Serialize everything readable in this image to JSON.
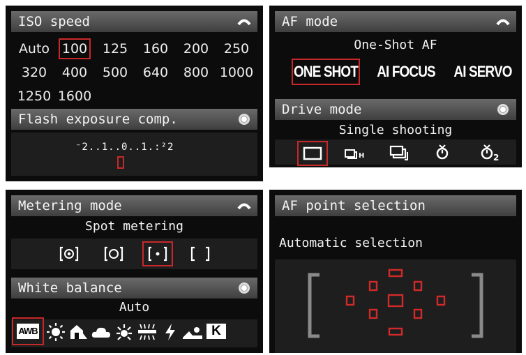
{
  "iso": {
    "title": "ISO speed",
    "header_icon": "eyebrow-arc-icon",
    "values": [
      "Auto",
      "100",
      "125",
      "160",
      "200",
      "250",
      "320",
      "400",
      "500",
      "640",
      "800",
      "1000",
      "1250",
      "1600"
    ],
    "selected": "100"
  },
  "flash": {
    "title": "Flash exposure comp.",
    "header_icon": "dial-icon",
    "scale": "⁻2..1..0..1.:²2",
    "value": 0
  },
  "af_mode": {
    "title": "AF mode",
    "header_icon": "eyebrow-arc-icon",
    "current": "One-Shot AF",
    "options": [
      "ONE SHOT",
      "AI FOCUS",
      "AI SERVO"
    ],
    "selected": "ONE SHOT"
  },
  "drive": {
    "title": "Drive mode",
    "header_icon": "dial-icon",
    "current": "Single shooting",
    "options": [
      "single-frame-icon",
      "continuous-high-icon",
      "continuous-low-icon",
      "self-timer-10s-icon",
      "self-timer-2s-icon"
    ],
    "selected": "single-frame-icon"
  },
  "metering": {
    "title": "Metering mode",
    "header_icon": "eyebrow-arc-icon",
    "current": "Spot metering",
    "options": [
      "evaluative-metering-icon",
      "partial-metering-icon",
      "spot-metering-icon",
      "center-weighted-metering-icon"
    ],
    "selected": "spot-metering-icon"
  },
  "white_balance": {
    "title": "White balance",
    "header_icon": "dial-icon",
    "current": "Auto",
    "options": [
      "awb-icon",
      "daylight-icon",
      "shade-icon",
      "cloudy-icon",
      "tungsten-icon",
      "fluorescent-icon",
      "flash-icon",
      "custom-wb-icon",
      "kelvin-icon"
    ],
    "auto_label": "AWB",
    "kelvin_label": "K",
    "selected": "awb-icon"
  },
  "af_point": {
    "title": "AF point selection",
    "current": "Automatic selection",
    "points": 9
  },
  "colors": {
    "selection": "#c8282a",
    "af_point": "#d22a2a",
    "bracket": "#8a8a8a"
  }
}
